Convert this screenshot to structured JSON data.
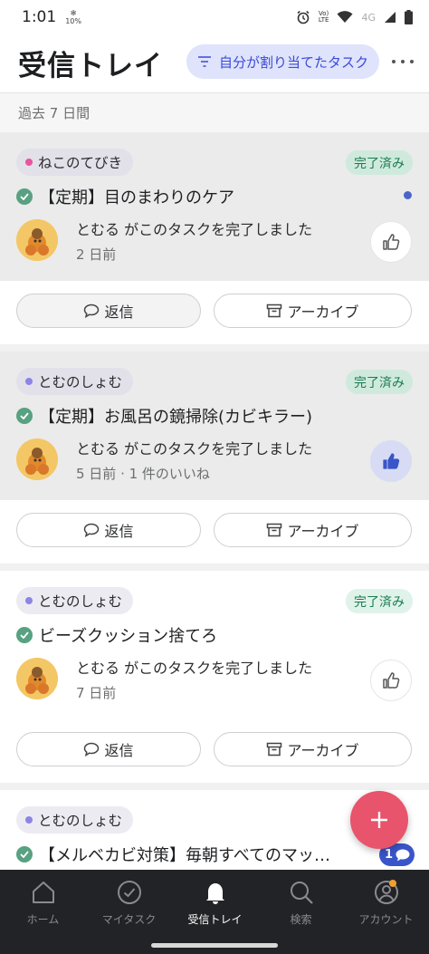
{
  "status_bar": {
    "time": "1:01",
    "net_speed": "10%",
    "volte": "Vo)\nLTE",
    "network": "4G"
  },
  "header": {
    "title": "受信トレイ",
    "filter_label": "自分が割り当てたタスク"
  },
  "section": {
    "label": "過去 7 日間"
  },
  "cards": [
    {
      "project": "ねこのてびき",
      "project_color": "#e8559b",
      "status": "完了済み",
      "task": "【定期】目のまわりのケア",
      "activity": "とむる がこのタスクを完了しました",
      "meta": "2 日前",
      "liked": false,
      "unread": true,
      "reply_label": "返信",
      "archive_label": "アーカイブ"
    },
    {
      "project": "とむのしょむ",
      "project_color": "#8d84e6",
      "status": "完了済み",
      "task": "【定期】お風呂の鏡掃除(カビキラー)",
      "activity": "とむる がこのタスクを完了しました",
      "meta": "5 日前 · 1 件のいいね",
      "liked": true,
      "unread": false,
      "reply_label": "返信",
      "archive_label": "アーカイブ"
    },
    {
      "project": "とむのしょむ",
      "project_color": "#8d84e6",
      "status": "完了済み",
      "task": "ビーズクッション捨てろ",
      "activity": "とむる がこのタスクを完了しました",
      "meta": "7 日前",
      "liked": false,
      "unread": false,
      "reply_label": "返信",
      "archive_label": "アーカイブ"
    },
    {
      "project": "とむのしょむ",
      "project_color": "#8d84e6",
      "task": "【メルベカビ対策】毎朝すべてのマッ…",
      "comment_count": "1"
    }
  ],
  "bottom_nav": {
    "items": [
      {
        "label": "ホーム",
        "icon": "home-icon"
      },
      {
        "label": "マイタスク",
        "icon": "check-circle-icon"
      },
      {
        "label": "受信トレイ",
        "icon": "bell-icon"
      },
      {
        "label": "検索",
        "icon": "search-icon"
      },
      {
        "label": "アカウント",
        "icon": "account-icon"
      }
    ]
  },
  "colors": {
    "accent": "#3a4ad8",
    "fab": "#e8546b",
    "complete_green": "#58a182",
    "nav_bg": "#222326"
  }
}
